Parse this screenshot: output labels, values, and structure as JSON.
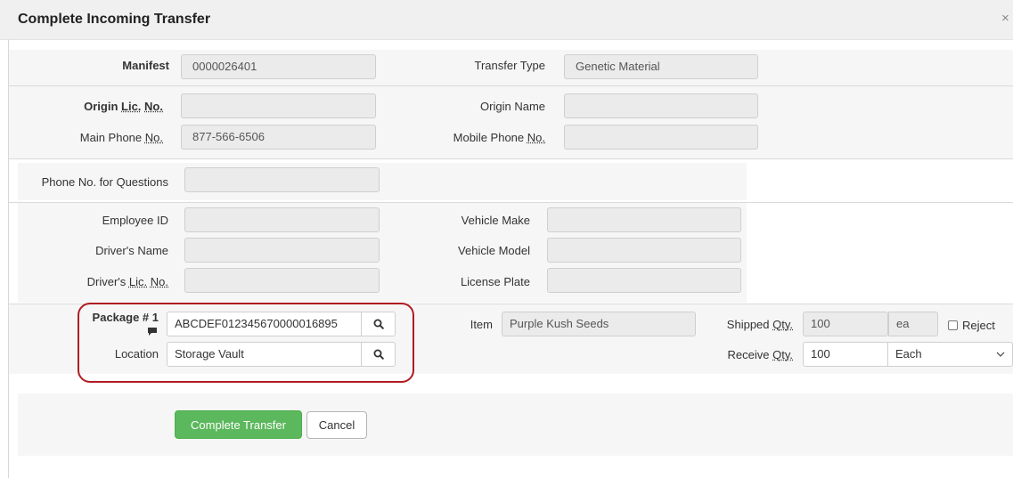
{
  "dialog": {
    "title": "Complete Incoming Transfer",
    "close_glyph": "×"
  },
  "manifest": {
    "label": "Manifest",
    "value": "0000026401"
  },
  "transfer_type": {
    "label": "Transfer Type",
    "value": "Genetic Material"
  },
  "origin_lic": {
    "label_pre": "Origin ",
    "label_abbr": "Lic.",
    "label_mid": " ",
    "label_abbr2": "No.",
    "value": ""
  },
  "origin_name": {
    "label": "Origin Name",
    "value": ""
  },
  "main_phone": {
    "label_pre": "Main Phone ",
    "label_abbr": "No.",
    "value": "877-566-6506"
  },
  "mobile_phone": {
    "label_pre": "Mobile Phone ",
    "label_abbr": "No.",
    "value": ""
  },
  "phone_questions": {
    "label": "Phone No. for Questions",
    "value": ""
  },
  "employee_id": {
    "label": "Employee ID",
    "value": ""
  },
  "vehicle_make": {
    "label": "Vehicle Make",
    "value": ""
  },
  "drivers_name": {
    "label": "Driver's Name",
    "value": ""
  },
  "vehicle_model": {
    "label": "Vehicle Model",
    "value": ""
  },
  "drivers_lic": {
    "label_pre": "Driver's ",
    "label_abbr": "Lic.",
    "label_mid": " ",
    "label_abbr2": "No.",
    "value": ""
  },
  "license_plate": {
    "label": "License Plate",
    "value": ""
  },
  "package": {
    "label": "Package # 1",
    "value": "ABCDEF012345670000016895"
  },
  "location": {
    "label": "Location",
    "value": "Storage Vault"
  },
  "item": {
    "label": "Item",
    "value": "Purple Kush Seeds"
  },
  "shipped_qty": {
    "label_pre": "Shipped ",
    "label_abbr": "Qty.",
    "value": "100",
    "unit": "ea"
  },
  "reject": {
    "label": "Reject",
    "checked": false
  },
  "receive_qty": {
    "label_pre": "Receive ",
    "label_abbr": "Qty.",
    "value": "100",
    "unit": "Each"
  },
  "actions": {
    "complete": "Complete Transfer",
    "cancel": "Cancel"
  },
  "colors": {
    "accent_green": "#5cb85c",
    "highlight_red": "#b01c22"
  },
  "icons": [
    "close-icon",
    "search-icon",
    "comment-icon",
    "chevron-down-icon"
  ]
}
